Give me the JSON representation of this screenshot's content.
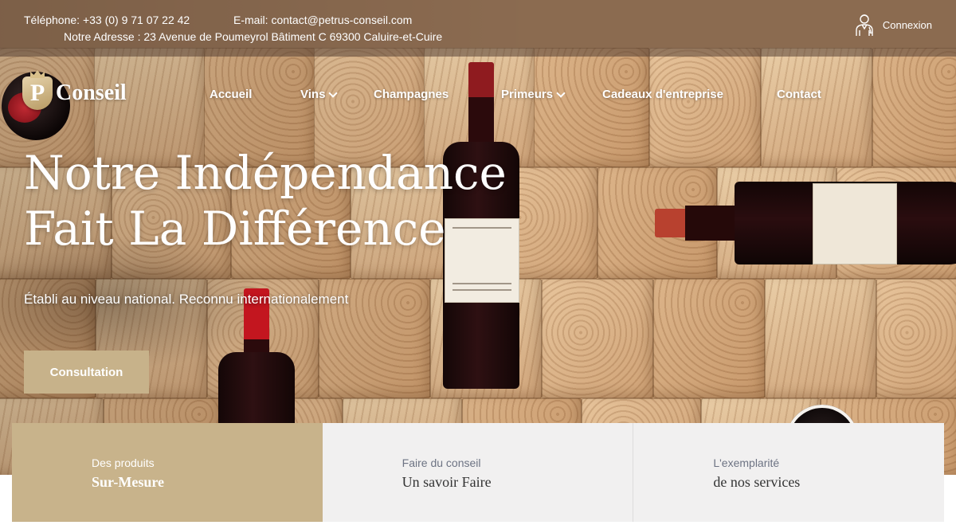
{
  "colors": {
    "accent": "#c7b28a",
    "card_bg": "#f1f0f0",
    "topbar_overlay": "#584234"
  },
  "topbar": {
    "phone": "Téléphone: +33 (0) 9 71 07 22 42",
    "email": "E-mail: contact@petrus-conseil.com",
    "address": "Notre Adresse : 23 Avenue de Poumeyrol Bâtiment C 69300 Caluire-et-Cuire",
    "login_icon": "sommelier-icon",
    "login_label": "Connexion"
  },
  "logo": {
    "initial": "P",
    "word": "Conseil"
  },
  "nav": {
    "items": [
      {
        "label": "Accueil",
        "dropdown": false
      },
      {
        "label": "Vins",
        "dropdown": true
      },
      {
        "label": "Champagnes",
        "dropdown": false
      },
      {
        "label": "Primeurs",
        "dropdown": true
      },
      {
        "label": "Cadeaux d'entreprise",
        "dropdown": false
      },
      {
        "label": "Contact",
        "dropdown": false
      }
    ]
  },
  "hero": {
    "title_line1": "Notre Indépendance",
    "title_line2": "Fait La Différence",
    "subtitle": "Établi au niveau national. Reconnu internationalement",
    "cta_label": "Consultation"
  },
  "cards": [
    {
      "small": "Des produits",
      "big": "Sur-Mesure"
    },
    {
      "small": "Faire du conseil",
      "big": "Un savoir Faire"
    },
    {
      "small": "L'exemplarité",
      "big": "de nos services"
    }
  ]
}
